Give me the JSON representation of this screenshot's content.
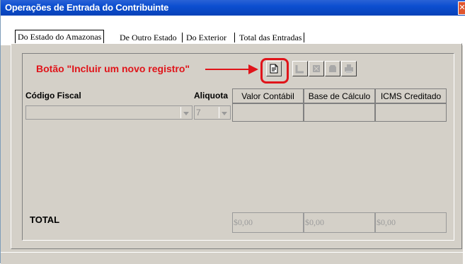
{
  "window": {
    "title": "Operações de Entrada do Contribuinte",
    "close_glyph": "✕"
  },
  "tabs": [
    {
      "label": "Do Estado do Amazonas",
      "active": true
    },
    {
      "label": "De Outro Estado",
      "active": false
    },
    {
      "label": "Do Exterior",
      "active": false
    },
    {
      "label": "Total das Entradas",
      "active": false
    }
  ],
  "annotation": {
    "text": "Botão \"Incluir um novo registro\"",
    "color": "#e0141a"
  },
  "toolbar": {
    "buttons": [
      {
        "name": "incluir-registro",
        "icon": "new-record-icon",
        "enabled": true
      },
      {
        "name": "salvar",
        "icon": "save-icon",
        "enabled": false
      },
      {
        "name": "excluir",
        "icon": "delete-icon",
        "enabled": false
      },
      {
        "name": "cancelar",
        "icon": "cancel-icon",
        "enabled": false
      },
      {
        "name": "imprimir",
        "icon": "print-icon",
        "enabled": false
      }
    ]
  },
  "grid": {
    "headers": [
      "Código Fiscal",
      "Aliquota",
      "Valor Contábil",
      "Base de Cálculo",
      "ICMS Creditado"
    ],
    "row": {
      "codigo_fiscal": "",
      "aliquota": "7",
      "valor_contabil": "",
      "base_calculo": "",
      "icms_creditado": ""
    }
  },
  "totals": {
    "label": "TOTAL",
    "valor_contabil": "$0,00",
    "base_calculo": "$0,00",
    "icms_creditado": "$0,00"
  }
}
